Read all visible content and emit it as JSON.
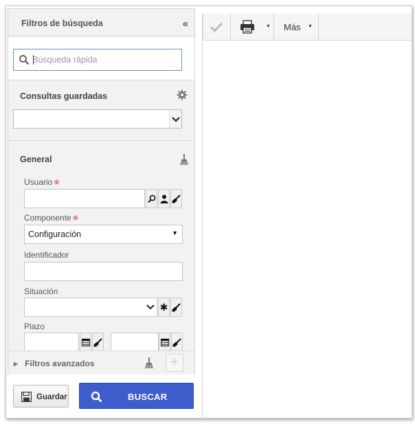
{
  "filters": {
    "title": "Filtros de búsqueda",
    "quick_search": {
      "placeholder": "Búsqueda rápida",
      "value": ""
    },
    "saved_queries": {
      "title": "Consultas guardadas",
      "selected": ""
    },
    "general": {
      "title": "General",
      "user": {
        "label": "Usuario",
        "value": ""
      },
      "component": {
        "label": "Componente",
        "selected": "Configuración"
      },
      "identifier": {
        "label": "Identificador",
        "value": ""
      },
      "status": {
        "label": "Situación",
        "value": ""
      },
      "deadline": {
        "label": "Plazo",
        "from": "",
        "to": ""
      }
    },
    "advanced": {
      "label": "Filtros avanzados"
    }
  },
  "actions": {
    "save_label": "Guardar",
    "search_label": "BUSCAR"
  },
  "toolbar": {
    "more_label": "Más"
  },
  "colors": {
    "primary": "#3d5dcc",
    "required": "#d33333",
    "panel_bg": "#f2f2f2"
  }
}
